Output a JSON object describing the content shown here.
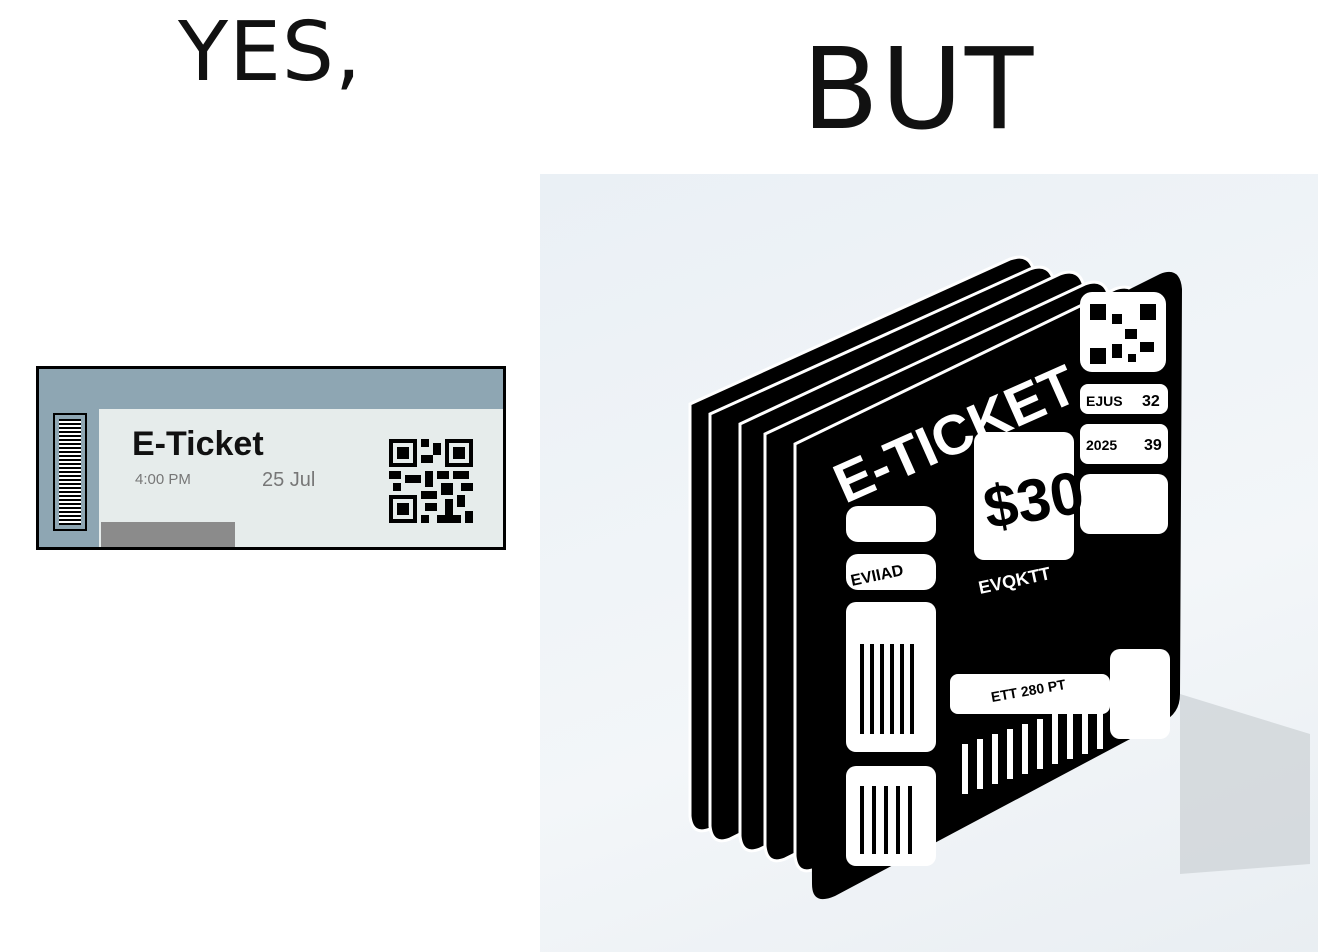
{
  "captions": {
    "left": "YES,",
    "right": "BUT"
  },
  "yes_ticket": {
    "title": "E-Ticket",
    "time": "4:00 PM",
    "date": "25 Jul",
    "colors": {
      "header": "#8ea6b3",
      "body": "#e6eceb",
      "footer_block": "#8b8b8b"
    }
  },
  "but_ticket": {
    "title": "E-TICKET",
    "price": "$30",
    "labels": [
      "EVIIAD",
      "EVQKTT",
      "EJUS",
      "32",
      "2025",
      "39",
      "ETT 280 PT"
    ]
  }
}
